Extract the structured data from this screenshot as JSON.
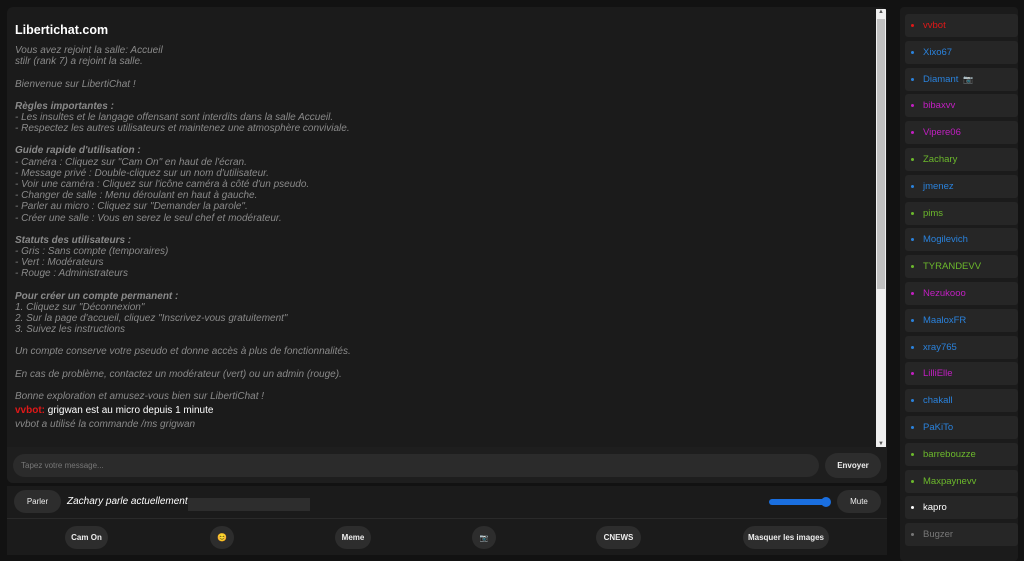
{
  "chat": {
    "title": "Libertichat.com",
    "system_lines": [
      "Vous avez rejoint la salle: Accueil",
      "stilr (rank 7) a rejoint la salle."
    ],
    "welcome": "Bienvenue sur LibertiChat !",
    "rules_heading": "Règles importantes :",
    "rules": [
      "- Les insultes et le langage offensant sont interdits dans la salle Accueil.",
      "- Respectez les autres utilisateurs et maintenez une atmosphère conviviale."
    ],
    "guide_heading": "Guide rapide d'utilisation :",
    "guide": [
      "- Caméra : Cliquez sur \"Cam On\" en haut de l'écran.",
      "- Message privé : Double-cliquez sur un nom d'utilisateur.",
      "- Voir une caméra : Cliquez sur l'icône caméra à côté d'un pseudo.",
      "- Changer de salle : Menu déroulant en haut à gauche.",
      "- Parler au micro : Cliquez sur \"Demander la parole\".",
      "- Créer une salle : Vous en serez le seul chef et modérateur."
    ],
    "status_heading": "Statuts des utilisateurs :",
    "status": [
      "- Gris : Sans compte (temporaires)",
      "- Vert : Modérateurs",
      "- Rouge : Administrateurs"
    ],
    "account_heading": "Pour créer un compte permanent :",
    "account": [
      "1. Cliquez sur \"Déconnexion\"",
      "2. Sur la page d'accueil, cliquez \"Inscrivez-vous gratuitement\"",
      "3. Suivez les instructions"
    ],
    "account_note": "Un compte conserve votre pseudo et donne accès à plus de fonctionnalités.",
    "problem_note": "En cas de problème, contactez un modérateur (vert) ou un admin (rouge).",
    "goodbye": "Bonne exploration et amusez-vous bien sur LibertiChat !",
    "message": {
      "user": "vvbot:",
      "text": " grigwan est au micro depuis 1 minute"
    },
    "command_line": "vvbot a utilisé la commande /ms grigwan"
  },
  "input": {
    "placeholder": "Tapez votre message...",
    "send_label": "Envoyer"
  },
  "speak": {
    "button": "Parler",
    "status": "Zachary parle actuellement",
    "mute": "Mute",
    "volume_percent": 100
  },
  "toolbar": {
    "cam_on": "Cam On",
    "emoji": "😊",
    "meme": "Meme",
    "camera_icon": "📷",
    "cnews": "CNEWS",
    "hide_images": "Masquer les images"
  },
  "colors": {
    "admin": "#e01818",
    "blue": "#2a82dc",
    "magenta": "#c21fc2",
    "green": "#6cb92c",
    "white": "#ffffff",
    "gray": "#777777"
  },
  "users": [
    {
      "name": "vvbot",
      "color": "admin"
    },
    {
      "name": "Xixo67",
      "color": "blue"
    },
    {
      "name": "Diamant",
      "color": "blue",
      "cam": "📷"
    },
    {
      "name": "bibaxvv",
      "color": "magenta"
    },
    {
      "name": "Vipere06",
      "color": "magenta"
    },
    {
      "name": "Zachary",
      "color": "green"
    },
    {
      "name": "jmenez",
      "color": "blue"
    },
    {
      "name": "pims",
      "color": "green"
    },
    {
      "name": "Mogilevich",
      "color": "blue"
    },
    {
      "name": "TYRANDEVV",
      "color": "green"
    },
    {
      "name": "Nezukooo",
      "color": "magenta"
    },
    {
      "name": "MaaloxFR",
      "color": "blue"
    },
    {
      "name": "xray765",
      "color": "blue"
    },
    {
      "name": "LilliElle",
      "color": "magenta"
    },
    {
      "name": "chakall",
      "color": "blue"
    },
    {
      "name": "PaKiTo",
      "color": "blue"
    },
    {
      "name": "barrebouzze",
      "color": "green"
    },
    {
      "name": "Maxpaynevv",
      "color": "green"
    },
    {
      "name": "kapro",
      "color": "white"
    },
    {
      "name": "Bugzer",
      "color": "gray"
    }
  ]
}
